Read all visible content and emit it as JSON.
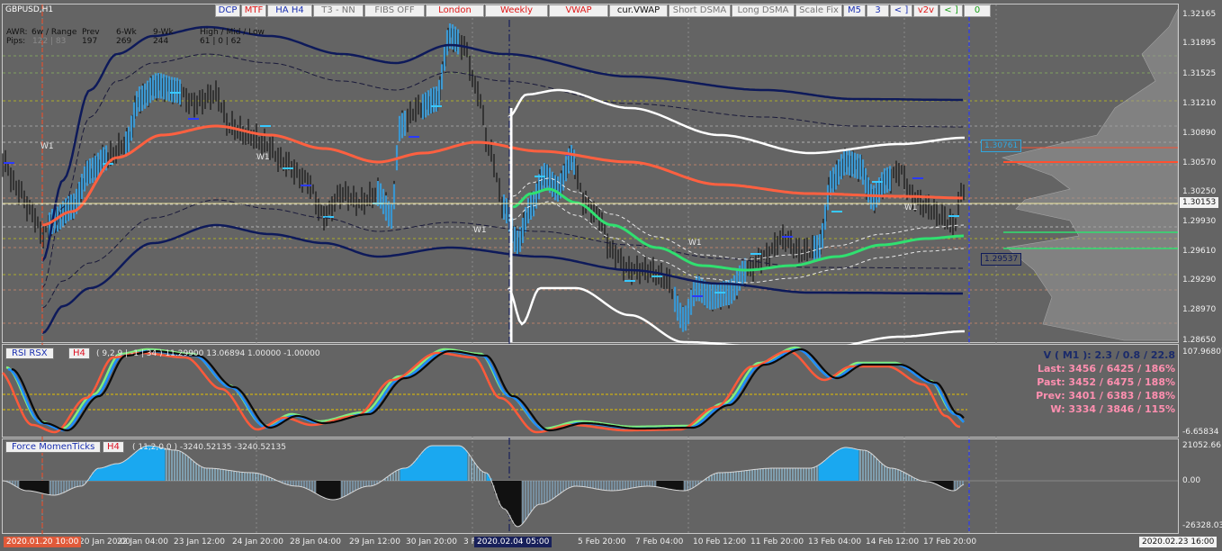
{
  "symbol": "GBPUSD,H1",
  "toolbar": [
    {
      "label": "DCP",
      "color": "#1a2fb0"
    },
    {
      "label": "MTF",
      "color": "#e01818"
    },
    {
      "label": "HA H4",
      "color": "#1a2fb0"
    },
    {
      "label": "T3 - NN",
      "color": "#777777"
    },
    {
      "label": "FIBS OFF",
      "color": "#777777"
    },
    {
      "label": "London",
      "color": "#e01818"
    },
    {
      "label": "Weekly",
      "color": "#e01818"
    },
    {
      "label": "VWAP",
      "color": "#e01818"
    },
    {
      "label": "cur.VWAP",
      "color": "#111111"
    },
    {
      "label": "Short DSMA",
      "color": "#777777"
    },
    {
      "label": "Long DSMA",
      "color": "#777777"
    },
    {
      "label": "Scale Fix",
      "color": "#777777"
    },
    {
      "label": "M5",
      "color": "#1a2fb0"
    },
    {
      "label": "3",
      "color": "#1a2fb0"
    },
    {
      "label": "< ]",
      "color": "#1a2fb0"
    },
    {
      "label": "v2v",
      "color": "#e01818"
    },
    {
      "label": "< ]",
      "color": "#18a018"
    },
    {
      "label": "0",
      "color": "#18a018"
    }
  ],
  "awr": {
    "row1": [
      "AWR:",
      "6w / Range",
      "Prev",
      "6-Wk",
      "9-Wk",
      "High / Mid / Low"
    ],
    "row2": [
      "Pips:",
      "122 | 83",
      "197",
      "269",
      "244",
      "61 | 0 | 62"
    ]
  },
  "price_axis": [
    "1.32165",
    "1.31895",
    "1.31525",
    "1.31210",
    "1.30890",
    "1.30570",
    "1.30250",
    "1.29930",
    "1.29610",
    "1.29290",
    "1.28970",
    "1.28650"
  ],
  "price_tags": {
    "upper": "1.30761",
    "current": "1.30153",
    "lower": "1.29537"
  },
  "w_markers": [
    "W1",
    "W1",
    "W1",
    "W1",
    "W1"
  ],
  "rsi": {
    "title": "RSI RSX",
    "tf": "H4",
    "params": "( 9,2,9 | -1 | 34 ) 11.29900 13.06894 1.00000 -1.00000",
    "axis_top": "107.96807",
    "axis_bottom": "-6.65834",
    "stats": [
      {
        "text": "V ( M1 ): 2.3 / 0.8 / 22.8",
        "color": "#1a2a6a"
      },
      {
        "text": "Last: 3456 / 6425 / 186%",
        "color": "#ff8fb0"
      },
      {
        "text": "Past: 3452 / 6475 / 188%",
        "color": "#ff8fb0"
      },
      {
        "text": "Prev: 3401 / 6383 / 188%",
        "color": "#ff8fb0"
      },
      {
        "text": "W: 3334 / 3846 / 115%",
        "color": "#ff8fb0"
      }
    ]
  },
  "force": {
    "title": "Force MomenTicks",
    "tf": "H4",
    "params": "( 11,2,0,0 ) -3240.52135 -3240.52135",
    "axis_top": "21052.661",
    "axis_mid": "0.00",
    "axis_bottom": "-26328.03"
  },
  "time_axis": [
    "20 Jan 20:00",
    "22 Jan 04:00",
    "23 Jan 12:00",
    "24 Jan 20:00",
    "28 Jan 04:00",
    "29 Jan 12:00",
    "30 Jan 20:00",
    "3 F",
    "5 Feb 20:00",
    "7 Feb 04:00",
    "10 Feb 12:00",
    "11 Feb 20:00",
    "13 Feb 04:00",
    "14 Feb 12:00",
    "17 Feb 20:00"
  ],
  "cursor_times": {
    "left": "2020.01.20 10:00",
    "mid": "2020.02.04 05:00",
    "right": "2020.02.23 16:00"
  },
  "colors": {
    "background": "#646464",
    "candle_blue": "#3aa0e0",
    "vwap_red": "#ff6040",
    "vwap_green": "#30e070",
    "band_navy": "#0e1a5a",
    "band_white": "#ffffff"
  }
}
